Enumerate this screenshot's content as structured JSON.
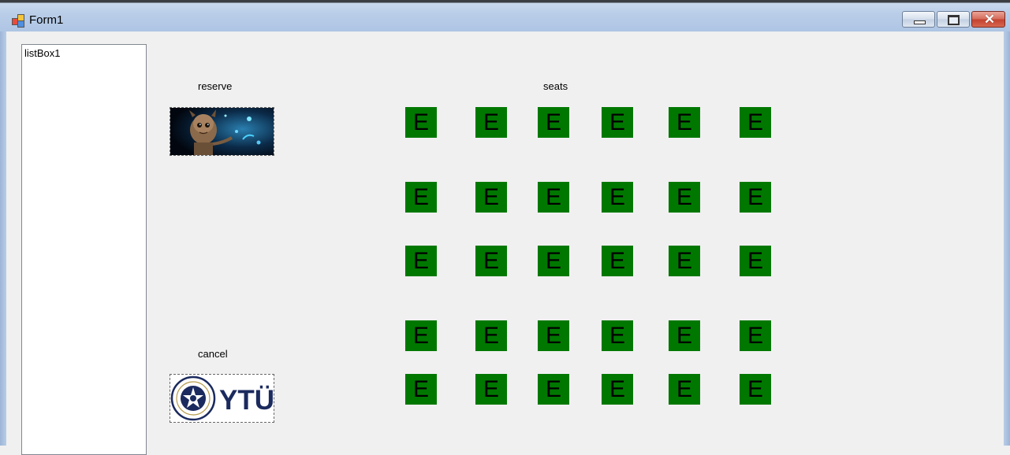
{
  "window": {
    "title": "Form1",
    "controls": [
      "minimize",
      "maximize",
      "close"
    ]
  },
  "listbox": {
    "items": [
      "listBox1"
    ]
  },
  "labels": {
    "reserve": "reserve",
    "seats": "seats",
    "cancel": "cancel"
  },
  "pictures": {
    "reserve_image": "groot-icon",
    "cancel_image": "ytu-logo-icon",
    "cancel_logo_text": "YTÜ"
  },
  "seat_grid": {
    "rows": [
      [
        "E",
        "E",
        "E",
        "E",
        "E",
        "E"
      ],
      [
        "E",
        "E",
        "E",
        "E",
        "E",
        "E"
      ],
      [
        "E",
        "E",
        "E",
        "E",
        "E",
        "E"
      ],
      [
        "E",
        "E",
        "E",
        "E",
        "E",
        "E"
      ],
      [
        "E",
        "E",
        "E",
        "E",
        "E",
        "E"
      ]
    ],
    "empty_color": "#007800"
  },
  "colors": {
    "background": "#f0f0f0",
    "seat_empty": "#007800"
  }
}
